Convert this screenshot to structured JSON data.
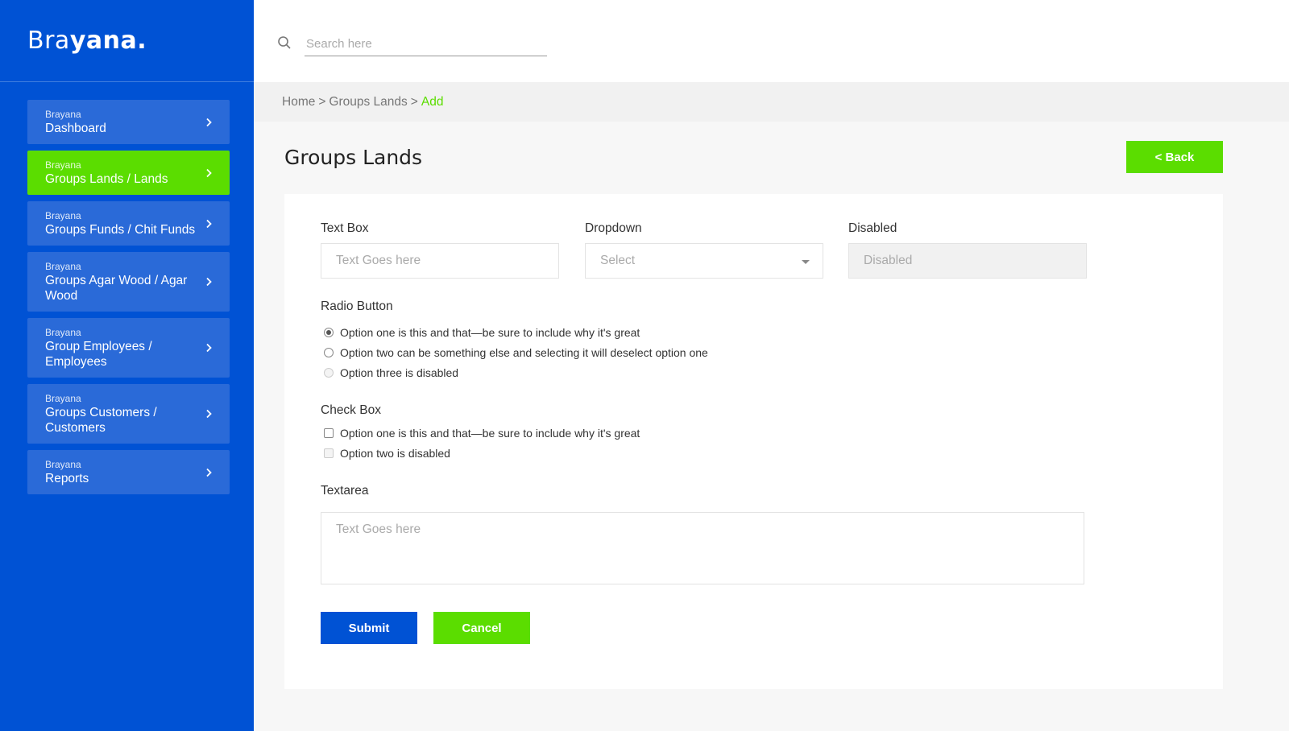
{
  "brand": {
    "light": "Bra",
    "bold": "yana",
    "dot": "."
  },
  "search": {
    "placeholder": "Search here",
    "value": ""
  },
  "sidebar": {
    "items": [
      {
        "sub": "Brayana",
        "label": "Dashboard",
        "active": false
      },
      {
        "sub": "Brayana",
        "label": "Groups Lands / Lands",
        "active": true
      },
      {
        "sub": "Brayana",
        "label": "Groups Funds / Chit Funds",
        "active": false
      },
      {
        "sub": "Brayana",
        "label": "Groups Agar Wood / Agar Wood",
        "active": false
      },
      {
        "sub": "Brayana",
        "label": "Group Employees / Employees",
        "active": false
      },
      {
        "sub": "Brayana",
        "label": "Groups Customers / Customers",
        "active": false
      },
      {
        "sub": "Brayana",
        "label": "Reports",
        "active": false
      }
    ]
  },
  "breadcrumb": {
    "items": [
      "Home",
      "Groups Lands"
    ],
    "separator": ">",
    "current": "Add"
  },
  "page": {
    "title": "Groups Lands",
    "back_label": "< Back"
  },
  "form": {
    "textbox": {
      "label": "Text Box",
      "placeholder": "Text Goes here",
      "value": ""
    },
    "dropdown": {
      "label": "Dropdown",
      "selected": "Select"
    },
    "disabled": {
      "label": "Disabled",
      "placeholder": "Disabled"
    },
    "radio": {
      "label": "Radio Button",
      "options": [
        {
          "text": "Option one is this and that—be sure to include why it's great",
          "checked": true,
          "disabled": false
        },
        {
          "text": "Option two can be something else and selecting it will deselect option one",
          "checked": false,
          "disabled": false
        },
        {
          "text": "Option three is disabled",
          "checked": false,
          "disabled": true
        }
      ]
    },
    "checkbox": {
      "label": "Check Box",
      "options": [
        {
          "text": "Option one is this and that—be sure to include why it's great",
          "checked": false,
          "disabled": false
        },
        {
          "text": "Option two is disabled",
          "checked": false,
          "disabled": true
        }
      ]
    },
    "textarea": {
      "label": "Textarea",
      "placeholder": "Text Goes here",
      "value": ""
    },
    "submit_label": "Submit",
    "cancel_label": "Cancel"
  },
  "colors": {
    "primary": "#0052d4",
    "accent": "#5bdd00",
    "nav_item": "#2a6ad8"
  }
}
